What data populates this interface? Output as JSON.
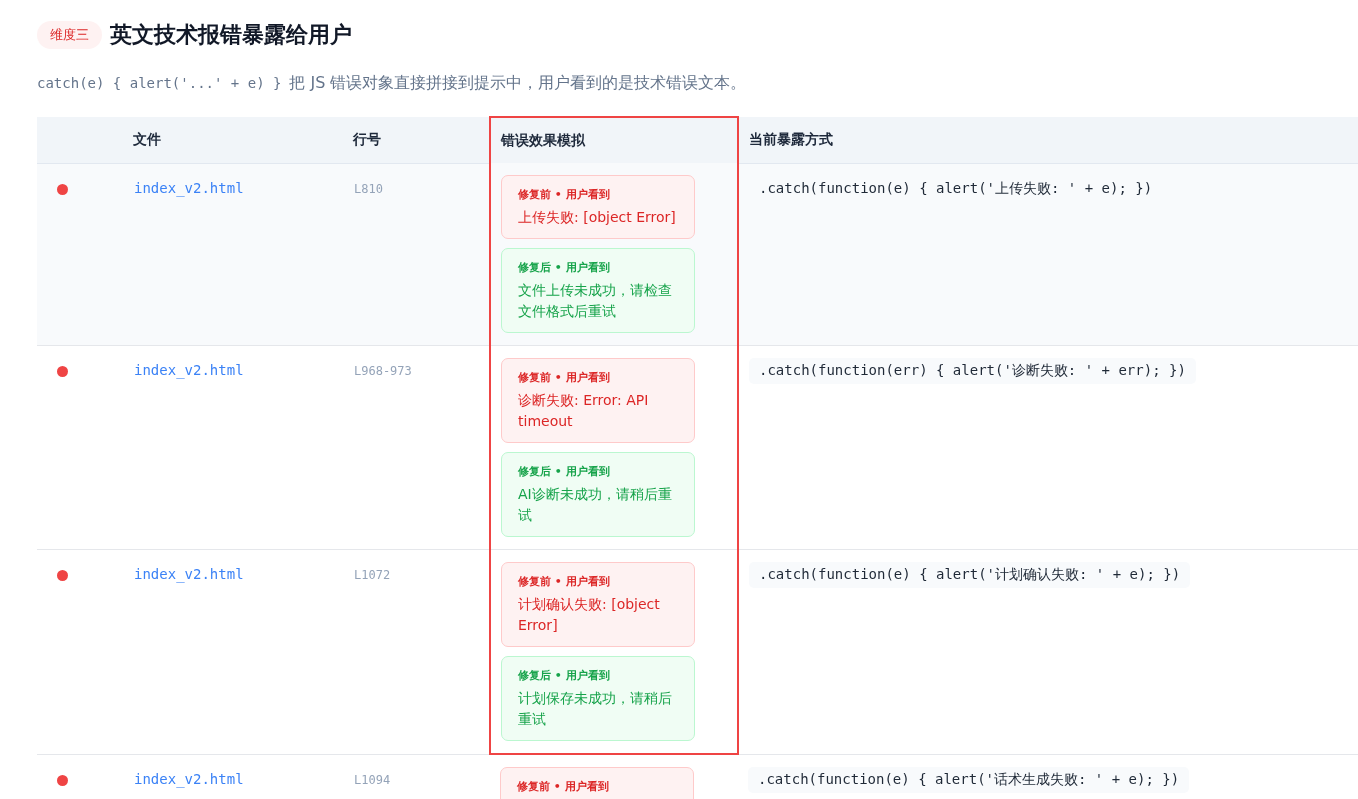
{
  "section": {
    "badge": "维度三",
    "title": "英文技术报错暴露给用户"
  },
  "description": {
    "code": "catch(e) { alert('...' + e) }",
    "text": "把 JS 错误对象直接拼接到提示中，用户看到的是技术错误文本。"
  },
  "table": {
    "columns": [
      {
        "framed": false
      },
      {
        "label": "文件",
        "framed": false
      },
      {
        "label": "行号",
        "framed": false
      },
      {
        "label": "错误效果模拟",
        "framed": true
      },
      {
        "label": "当前暴露方式",
        "framed": false
      }
    ],
    "rows": [
      {
        "color": "#ef4444",
        "file": "index_v2.html",
        "line": "L810",
        "highlighted": true,
        "framed": true,
        "before": {
          "label": "修复前 • 用户看到",
          "text": "上传失败: [object Error]"
        },
        "after": {
          "label": "修复后 • 用户看到",
          "text": "文件上传未成功，请检查文件格式后重试"
        },
        "code": ".catch(function(e) { alert('上传失败: ' + e); })"
      },
      {
        "color": "#ef4444",
        "file": "index_v2.html",
        "line": "L968-973",
        "highlighted": false,
        "framed": true,
        "before": {
          "label": "修复前 • 用户看到",
          "text": "诊断失败: Error: API timeout"
        },
        "after": {
          "label": "修复后 • 用户看到",
          "text": "AI诊断未成功，请稍后重试"
        },
        "code": ".catch(function(err) { alert('诊断失败: ' + err); })"
      },
      {
        "color": "#ef4444",
        "file": "index_v2.html",
        "line": "L1072",
        "highlighted": false,
        "framed": true,
        "before": {
          "label": "修复前 • 用户看到",
          "text": "计划确认失败: [object Error]"
        },
        "after": {
          "label": "修复后 • 用户看到",
          "text": "计划保存未成功，请稍后重试"
        },
        "code": ".catch(function(e) { alert('计划确认失败: ' + e); })"
      },
      {
        "color": "#ef4444",
        "file": "index_v2.html",
        "line": "L1094",
        "highlighted": false,
        "framed": false,
        "before": {
          "label": "修复前 • 用户看到"
        },
        "code": ".catch(function(e) { alert('话术生成失败: ' + e); })"
      }
    ]
  }
}
